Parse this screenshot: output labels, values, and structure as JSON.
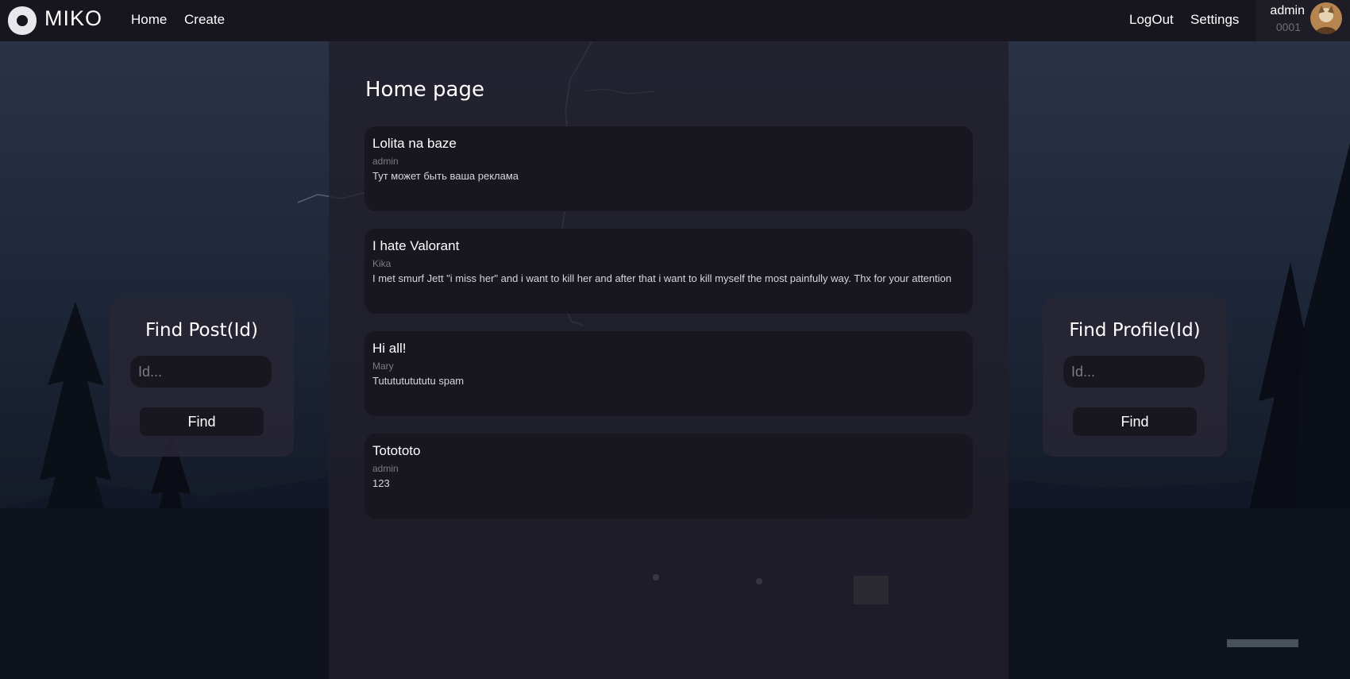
{
  "header": {
    "brand": "MIKO",
    "nav": [
      {
        "label": "Home"
      },
      {
        "label": "Create"
      }
    ],
    "logout_label": "LogOut",
    "settings_label": "Settings",
    "user": {
      "name": "admin",
      "id": "0001"
    }
  },
  "main": {
    "title": "Home page",
    "posts": [
      {
        "title": "Lolita na baze",
        "author": "admin",
        "body": "Тут может быть ваша реклама"
      },
      {
        "title": "I hate Valorant",
        "author": "Kika",
        "body": "I met smurf Jett \"i miss her\" and i want to kill her and after that i want to kill myself the most painfully way. Thx for your attention"
      },
      {
        "title": "Hi all!",
        "author": "Mary",
        "body": "Tututututututu spam"
      },
      {
        "title": "Totototo",
        "author": "admin",
        "body": "123"
      }
    ]
  },
  "find_post": {
    "title": "Find Post(Id)",
    "placeholder": "Id...",
    "button": "Find"
  },
  "find_profile": {
    "title": "Find Profile(Id)",
    "placeholder": "Id...",
    "button": "Find"
  },
  "colors": {
    "topbar": "#17151d",
    "card": "#18161e",
    "panel": "#211f2a",
    "muted": "#7c7a85"
  }
}
